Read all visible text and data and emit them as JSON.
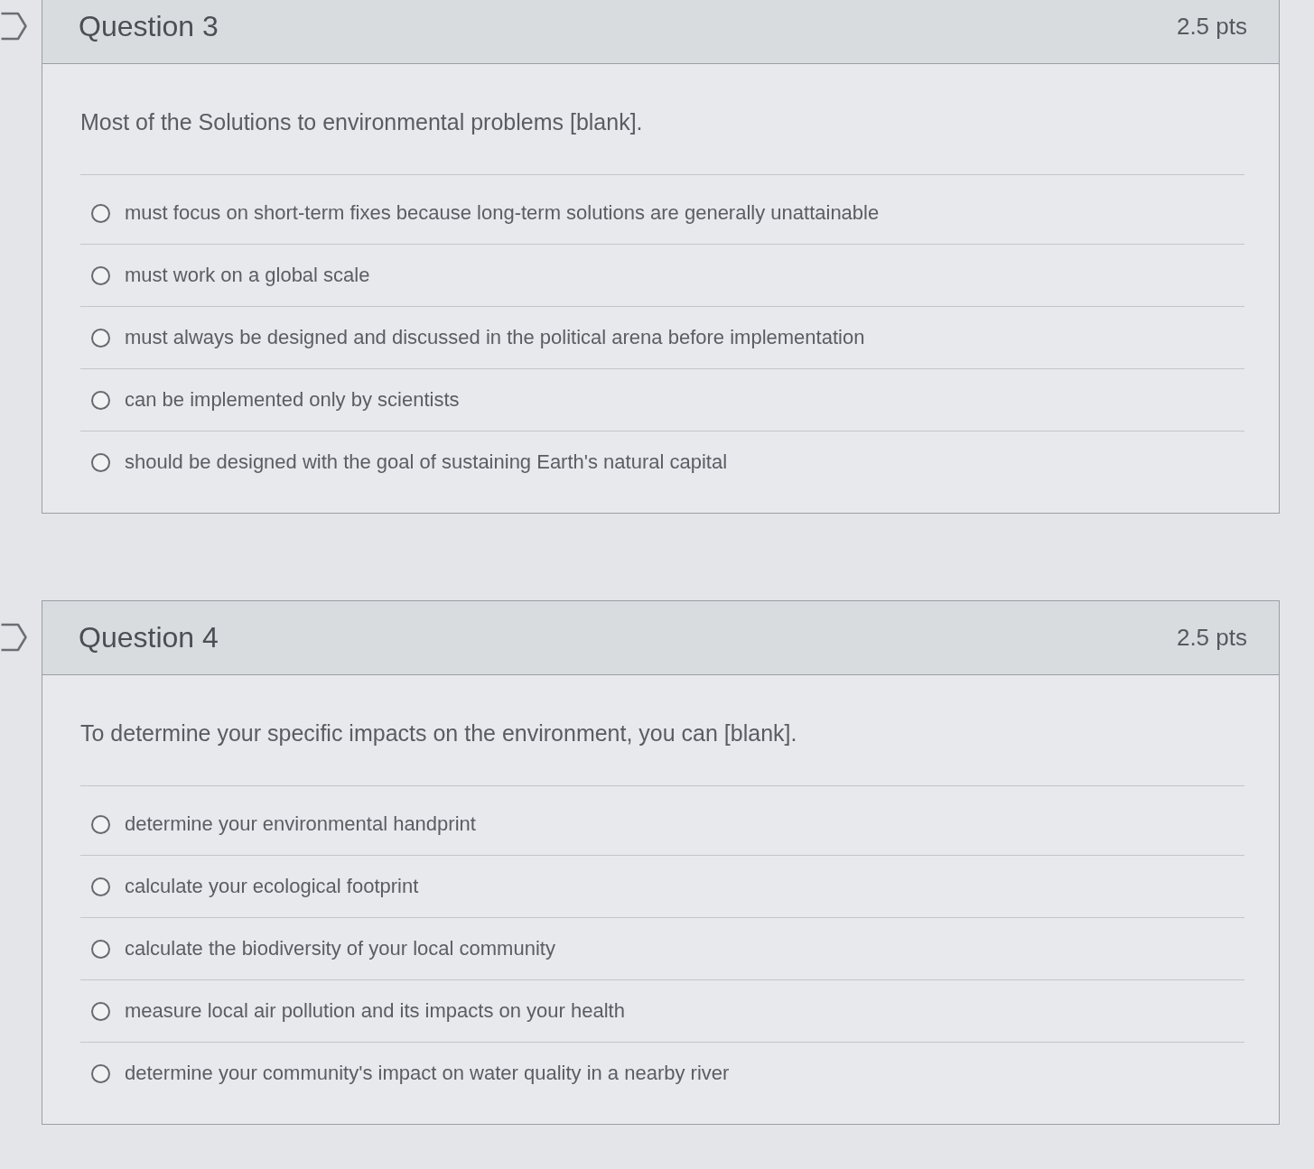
{
  "questions": [
    {
      "title": "Question 3",
      "points": "2.5 pts",
      "prompt": "Most of the Solutions to environmental problems [blank].",
      "answers": [
        {
          "text": "must focus on short-term fixes because long-term solutions are generally unattainable",
          "selected": false
        },
        {
          "text": "must work on a global scale",
          "selected": false
        },
        {
          "text": "must always be designed and discussed in the political arena before implementation",
          "selected": false
        },
        {
          "text": "can be implemented only by scientists",
          "selected": false
        },
        {
          "text": "should be designed with the goal of sustaining Earth's natural capital",
          "selected": false
        }
      ]
    },
    {
      "title": "Question 4",
      "points": "2.5 pts",
      "prompt": "To determine your specific impacts on the environment, you can [blank].",
      "answers": [
        {
          "text": "determine your environmental handprint",
          "selected": false
        },
        {
          "text": "calculate your ecological footprint",
          "selected": false
        },
        {
          "text": "calculate the biodiversity of your local community",
          "selected": false
        },
        {
          "text": "measure local air pollution and its impacts on your health",
          "selected": false
        },
        {
          "text": "determine your community's impact on water quality in a nearby river",
          "selected": false
        }
      ]
    }
  ]
}
